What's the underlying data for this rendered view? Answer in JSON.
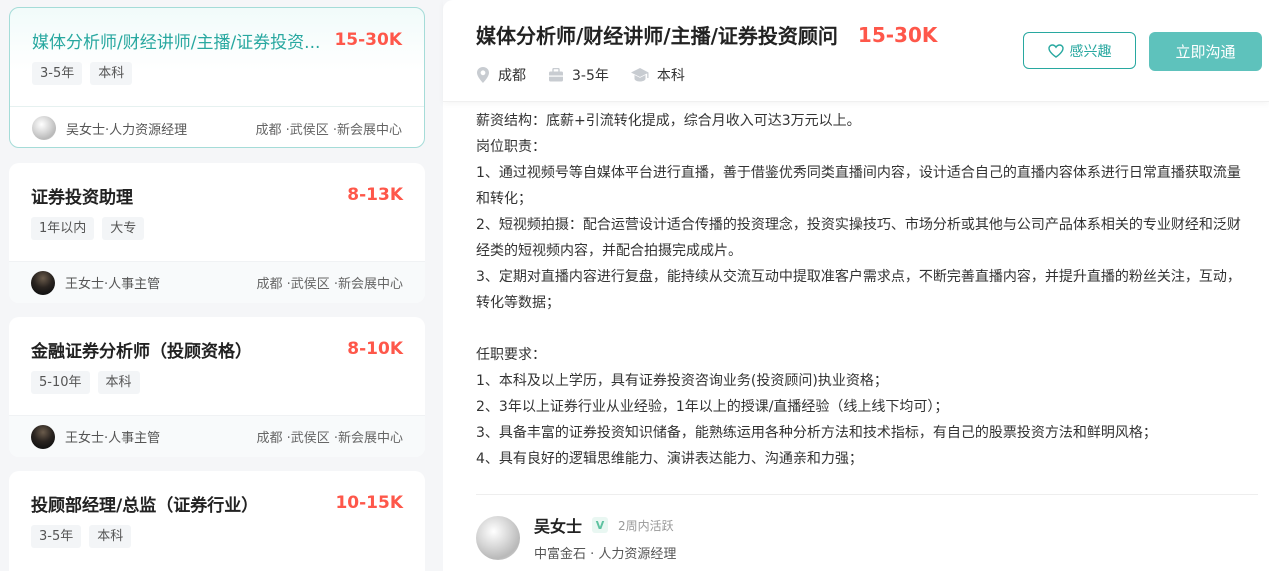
{
  "jobs": [
    {
      "title": "媒体分析师/财经讲师/主播/证券投资...",
      "salary": "15-30K",
      "tags": [
        "3-5年",
        "本科"
      ],
      "recruiter": "吴女士·人力资源经理",
      "location": "成都 ·武侯区 ·新会展中心"
    },
    {
      "title": "证券投资助理",
      "salary": "8-13K",
      "tags": [
        "1年以内",
        "大专"
      ],
      "recruiter": "王女士·人事主管",
      "location": "成都 ·武侯区 ·新会展中心"
    },
    {
      "title": "金融证券分析师（投顾资格）",
      "salary": "8-10K",
      "tags": [
        "5-10年",
        "本科"
      ],
      "recruiter": "王女士·人事主管",
      "location": "成都 ·武侯区 ·新会展中心"
    },
    {
      "title": "投顾部经理/总监（证券行业）",
      "salary": "10-15K",
      "tags": [
        "3-5年",
        "本科"
      ]
    }
  ],
  "detail": {
    "title": "媒体分析师/财经讲师/主播/证券投资顾问",
    "salary": "15-30K",
    "city": "成都",
    "experience": "3-5年",
    "education": "本科",
    "fav_label": "感兴趣",
    "chat_label": "立即沟通",
    "description": [
      "薪资结构：底薪+引流转化提成，综合月收入可达3万元以上。",
      "岗位职责：",
      "1、通过视频号等自媒体平台进行直播，善于借鉴优秀同类直播间内容，设计适合自己的直播内容体系进行日常直播获取流量和转化；",
      "2、短视频拍摄：配合运营设计适合传播的投资理念，投资实操技巧、市场分析或其他与公司产品体系相关的专业财经和泛财经类的短视频内容，并配合拍摄完成成片。",
      "3、定期对直播内容进行复盘，能持续从交流互动中提取准客户需求点，不断完善直播内容，并提升直播的粉丝关注，互动，转化等数据；",
      "",
      "任职要求：",
      "1、本科及以上学历，具有证券投资咨询业务(投资顾问)执业资格；",
      "2、3年以上证券行业从业经验，1年以上的授课/直播经验（线上线下均可）；",
      "3、具备丰富的证券投资知识储备，能熟练运用各种分析方法和技术指标，有自己的股票投资方法和鲜明风格；",
      "4、具有良好的逻辑思维能力、演讲表达能力、沟通亲和力强；"
    ],
    "boss": {
      "name": "吴女士",
      "badge": "V",
      "active": "2周内活跃",
      "company": "中富金石 · 人力资源经理"
    }
  },
  "colors": {
    "accent": "#28a8a0",
    "salary": "#fe574a",
    "button": "#5ec2bc"
  }
}
